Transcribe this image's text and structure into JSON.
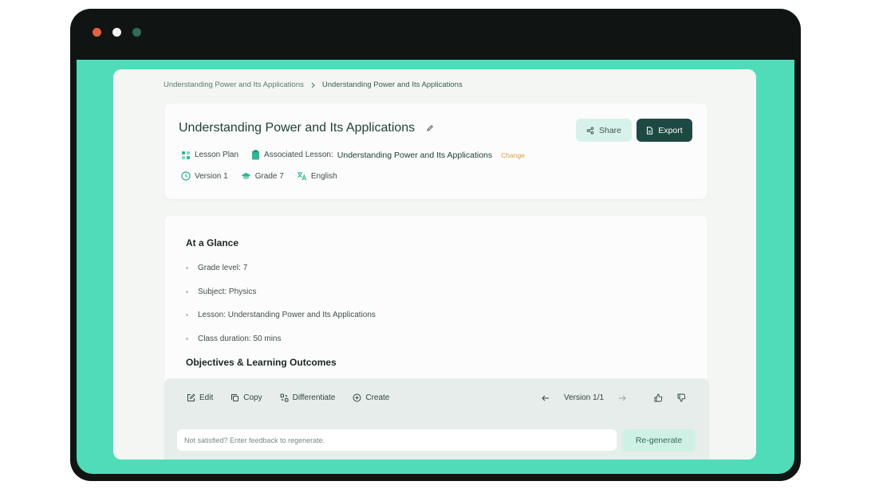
{
  "window": {
    "dot_colors": [
      "#e5623c",
      "#f2f2f2",
      "#2e6b58"
    ]
  },
  "breadcrumb": {
    "parent": "Understanding Power and Its Applications",
    "current": "Understanding Power and Its Applications"
  },
  "header": {
    "title": "Understanding Power and Its Applications",
    "share_label": "Share",
    "export_label": "Export",
    "type_label": "Lesson Plan",
    "associated_prefix": "Associated Lesson:",
    "associated_lesson": "Understanding Power and Its Applications",
    "change_label": "Change",
    "version": "Version 1",
    "grade": "Grade 7",
    "language": "English"
  },
  "content": {
    "glance_heading": "At a Glance",
    "items": [
      "Grade level: 7",
      "Subject: Physics",
      "Lesson: Understanding Power and Its Applications",
      "Class duration: 50 mins"
    ],
    "objectives_heading": "Objectives & Learning Outcomes"
  },
  "toolbar": {
    "edit": "Edit",
    "copy": "Copy",
    "differentiate": "Differentiate",
    "create": "Create",
    "version_label": "Version 1/1",
    "feedback_placeholder": "Not satisfied? Enter feedback to regenerate.",
    "regenerate": "Re-generate"
  },
  "colors": {
    "accent": "#4fdcb8",
    "primary_dark": "#1c4a42",
    "change": "#d9a23a"
  }
}
